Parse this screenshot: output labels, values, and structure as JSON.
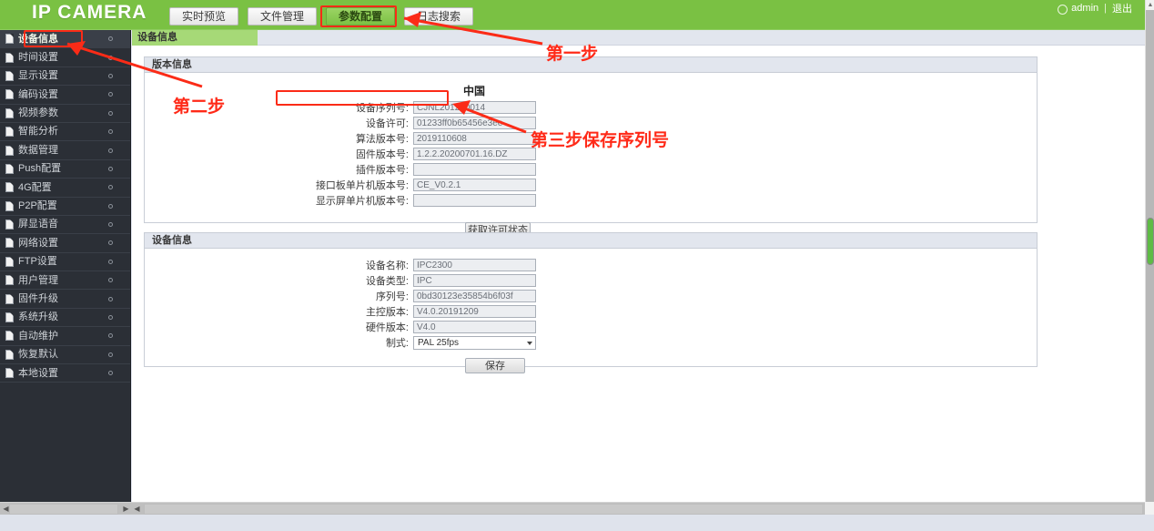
{
  "header": {
    "brand": "IP CAMERA",
    "tabs": [
      {
        "label": "实时预览",
        "active": false
      },
      {
        "label": "文件管理",
        "active": false
      },
      {
        "label": "参数配置",
        "active": true
      },
      {
        "label": "日志搜索",
        "active": false
      }
    ],
    "user": {
      "icon": "user-circle-icon",
      "name": "admin",
      "separator": "|",
      "logout": "退出"
    }
  },
  "sidebar": {
    "items": [
      {
        "label": "设备信息",
        "selected": true
      },
      {
        "label": "时间设置",
        "selected": false
      },
      {
        "label": "显示设置",
        "selected": false
      },
      {
        "label": "编码设置",
        "selected": false
      },
      {
        "label": "视频参数",
        "selected": false
      },
      {
        "label": "智能分析",
        "selected": false
      },
      {
        "label": "数据管理",
        "selected": false
      },
      {
        "label": "Push配置",
        "selected": false
      },
      {
        "label": "4G配置",
        "selected": false
      },
      {
        "label": "P2P配置",
        "selected": false
      },
      {
        "label": "屏显语音",
        "selected": false
      },
      {
        "label": "网络设置",
        "selected": false
      },
      {
        "label": "FTP设置",
        "selected": false
      },
      {
        "label": "用户管理",
        "selected": false
      },
      {
        "label": "固件升级",
        "selected": false
      },
      {
        "label": "系统升级",
        "selected": false
      },
      {
        "label": "自动维护",
        "selected": false
      },
      {
        "label": "恢复默认",
        "selected": false
      },
      {
        "label": "本地设置",
        "selected": false
      }
    ]
  },
  "breadcrumb": {
    "current": "设备信息"
  },
  "version_panel": {
    "title": "版本信息",
    "country": "中国",
    "fields": [
      {
        "label": "设备序列号:",
        "value": "CJNL201260014"
      },
      {
        "label": "设备许可:",
        "value": "01233ff0b65456e3ee"
      },
      {
        "label": "算法版本号:",
        "value": "2019110608"
      },
      {
        "label": "固件版本号:",
        "value": "1.2.2.20200701.16.DZ"
      },
      {
        "label": "插件版本号:",
        "value": ""
      },
      {
        "label": "接口板单片机版本号:",
        "value": "CE_V0.2.1"
      },
      {
        "label": "显示屏单片机版本号:",
        "value": ""
      }
    ],
    "button": "获取许可状态"
  },
  "device_panel": {
    "title": "设备信息",
    "fields": [
      {
        "label": "设备名称:",
        "value": "IPC2300"
      },
      {
        "label": "设备类型:",
        "value": "IPC"
      },
      {
        "label": "序列号:",
        "value": "0bd30123e35854b6f03f"
      },
      {
        "label": "主控版本:",
        "value": "V4.0.20191209"
      },
      {
        "label": "硬件版本:",
        "value": "V4.0"
      }
    ],
    "format": {
      "label": "制式:",
      "value": "PAL 25fps"
    },
    "button": "保存"
  },
  "annotations": {
    "step1": "第一步",
    "step2": "第二步",
    "step3": "第三步保存序列号",
    "color": "#ff2a18"
  },
  "colors": {
    "brand_green": "#7ac143",
    "crumb_green": "#a6d977",
    "sidebar_dark": "#2b2f36",
    "panel_header": "#e2e6ee",
    "annotation_red": "#ff2a18"
  },
  "scrollbars": {
    "v_up": "▲",
    "v_down": "▼",
    "h_left": "◀",
    "h_right": "▶"
  }
}
